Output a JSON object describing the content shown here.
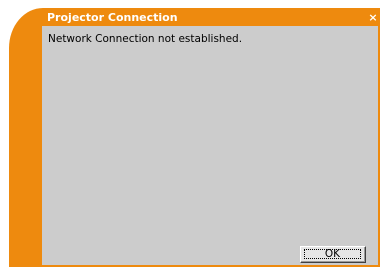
{
  "window": {
    "title": "Projector Connection",
    "close_glyph": "×",
    "close_icon": "close-icon"
  },
  "dialog": {
    "message": "Network Connection not established.",
    "ok_label": "OK"
  },
  "colors": {
    "frame": "#ee8a0e",
    "content": "#cccccc",
    "title_text": "#ffffff"
  }
}
